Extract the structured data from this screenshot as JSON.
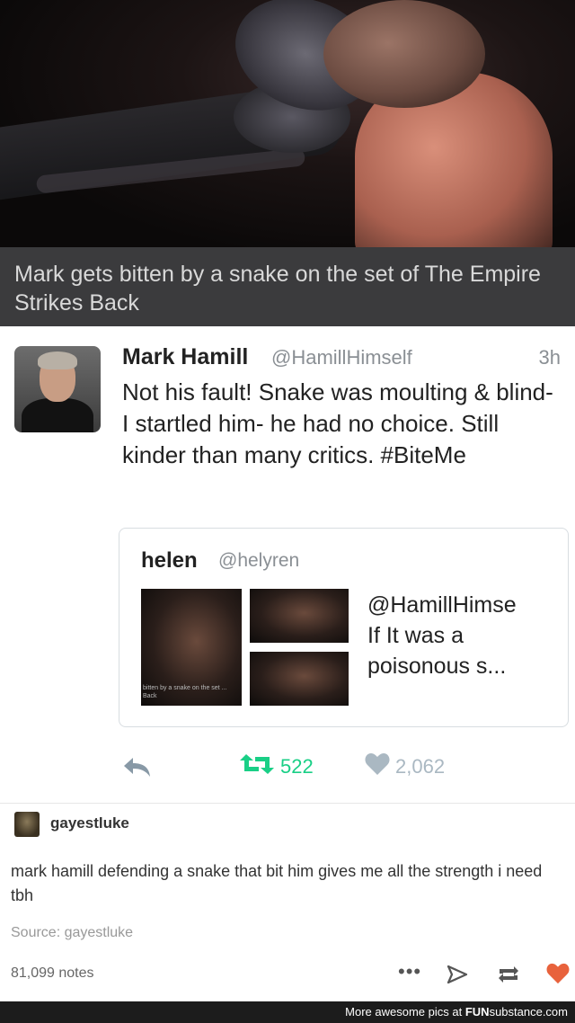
{
  "movie": {
    "caption": "Mark gets bitten by a snake on the set of The Empire Strikes Back"
  },
  "tweet": {
    "name": "Mark Hamill",
    "handle": "@HamillHimself",
    "time": "3h",
    "text": "Not his fault! Snake was moulting & blind- I startled him- he had no choice. Still kinder than many critics. #BiteMe",
    "quoted": {
      "name": "helen",
      "handle": "@helyren",
      "text_line1": "@HamillHimse",
      "text_line2": "If  It was a",
      "text_line3": "poisonous s...",
      "thumb_caption": "bitten by a snake on the set ... Back"
    },
    "retweets": "522",
    "likes": "2,062",
    "colors": {
      "retweet": "#19cf86",
      "like": "#aab8c2"
    }
  },
  "comment": {
    "username": "gayestluke",
    "text": "mark hamill defending a snake that bit him gives me all the strength i need tbh",
    "source": "Source: gayestluke"
  },
  "footer_actions": {
    "notes": "81,099 notes",
    "more": "•••",
    "heart_color": "#e8623c"
  },
  "watermark": {
    "prefix": "More awesome pics at ",
    "brand_bold": "FUN",
    "brand_rest": "substance.com"
  }
}
